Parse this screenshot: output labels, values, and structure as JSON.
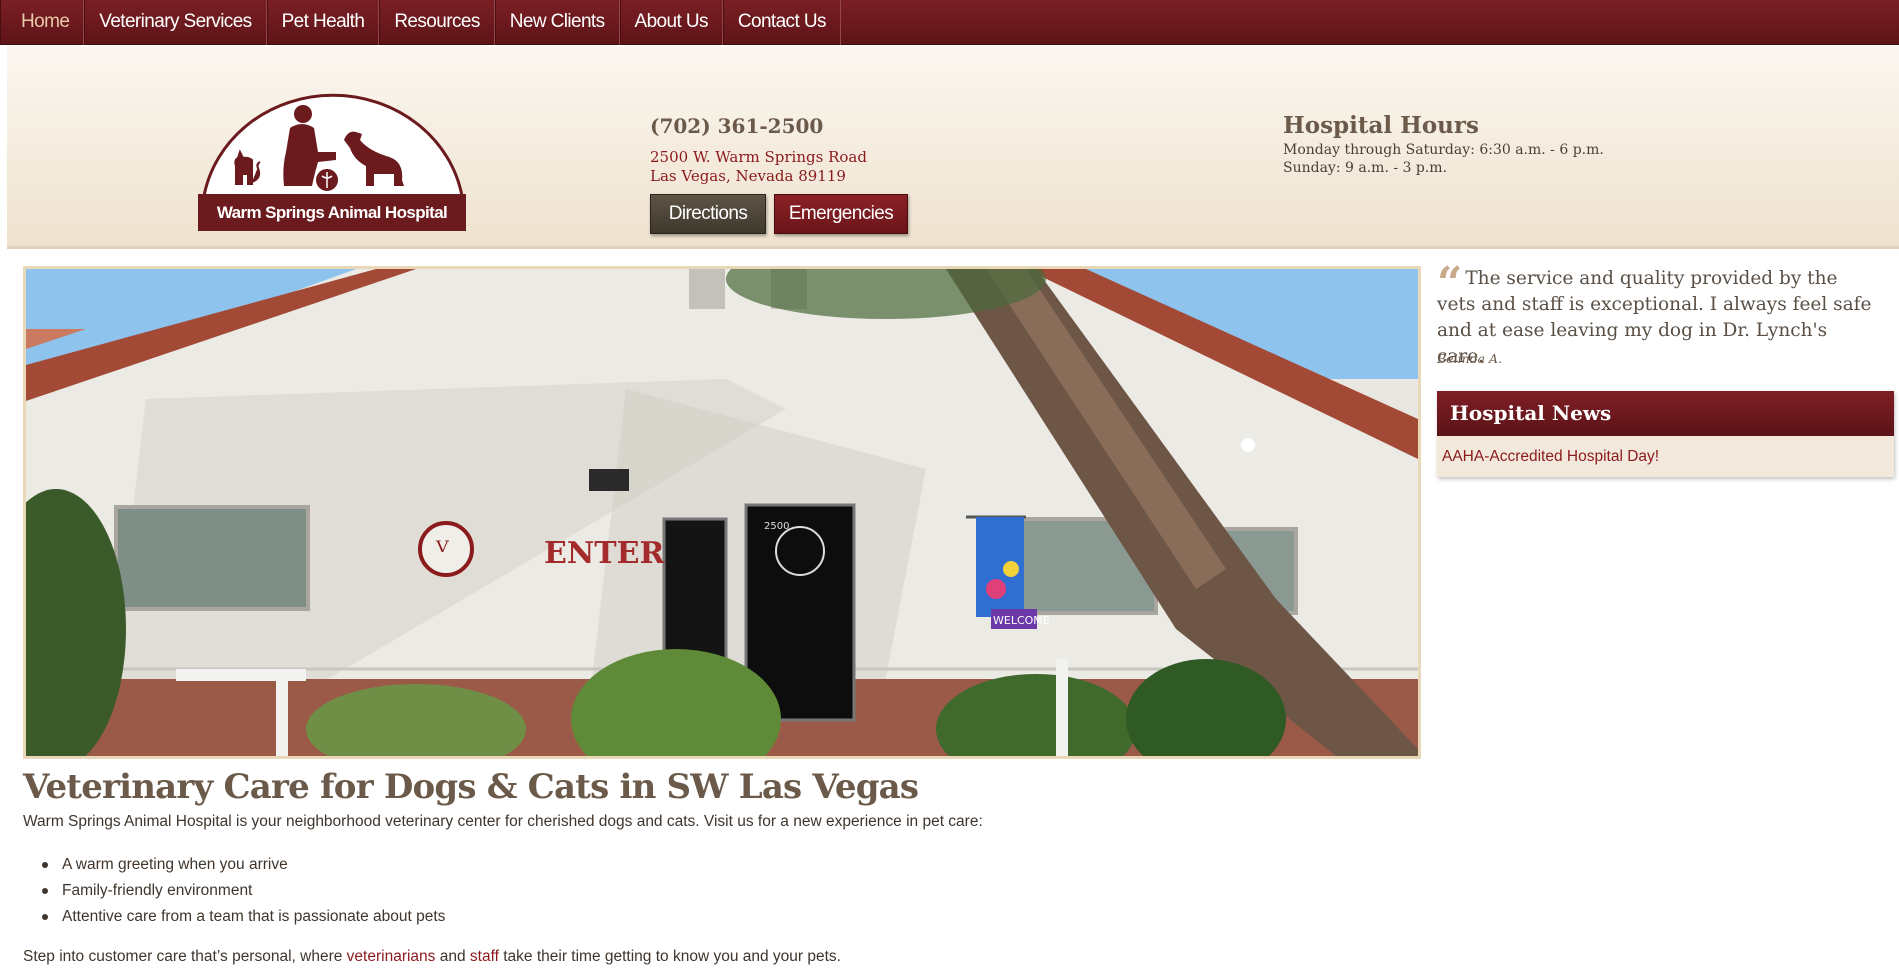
{
  "nav": {
    "items": [
      {
        "label": "Home",
        "active": true
      },
      {
        "label": "Veterinary Services",
        "active": false
      },
      {
        "label": "Pet Health",
        "active": false
      },
      {
        "label": "Resources",
        "active": false
      },
      {
        "label": "New Clients",
        "active": false
      },
      {
        "label": "About Us",
        "active": false
      },
      {
        "label": "Contact Us",
        "active": false
      }
    ]
  },
  "header": {
    "logo_text": "Warm Springs Animal Hospital",
    "phone": "(702) 361-2500",
    "address_line1": "2500 W. Warm Springs Road",
    "address_line2": "Las Vegas, Nevada 89119",
    "directions_label": "Directions",
    "emergencies_label": "Emergencies",
    "hours_title": "Hospital Hours",
    "hours_line1": "Monday through Saturday: 6:30 a.m. - 6 p.m.",
    "hours_line2": "Sunday: 9 a.m. - 3 p.m."
  },
  "hero": {
    "sign_text": "ENTER",
    "door_number": "2500",
    "flag_text": "WELCOME"
  },
  "testimonial": {
    "quote": "The service and quality provided by the vets and staff is exceptional. I always feel safe and at ease leaving my dog in Dr. Lynch's care.",
    "author": "Belinda A."
  },
  "news": {
    "title": "Hospital News",
    "items": [
      "AAHA-Accredited Hospital Day!"
    ]
  },
  "content": {
    "heading": "Veterinary Care for Dogs & Cats in SW Las Vegas",
    "intro": "Warm Springs Animal Hospital is your neighborhood veterinary center for cherished dogs and cats. Visit us for a new experience in pet care:",
    "bullets": [
      "A warm greeting when you arrive",
      "Family-friendly environment",
      "Attentive care from a team that is passionate about pets"
    ],
    "outro_before": "Step into customer care that’s personal, where ",
    "outro_link1": "veterinarians",
    "outro_middle": " and ",
    "outro_link2": "staff",
    "outro_after": " take their time getting to know you and your pets."
  },
  "colors": {
    "brand_maroon": "#6b1a1d",
    "heading_brown": "#6b5a4a",
    "link_red": "#8b1a1d",
    "header_cream": "#f4ebdd"
  }
}
